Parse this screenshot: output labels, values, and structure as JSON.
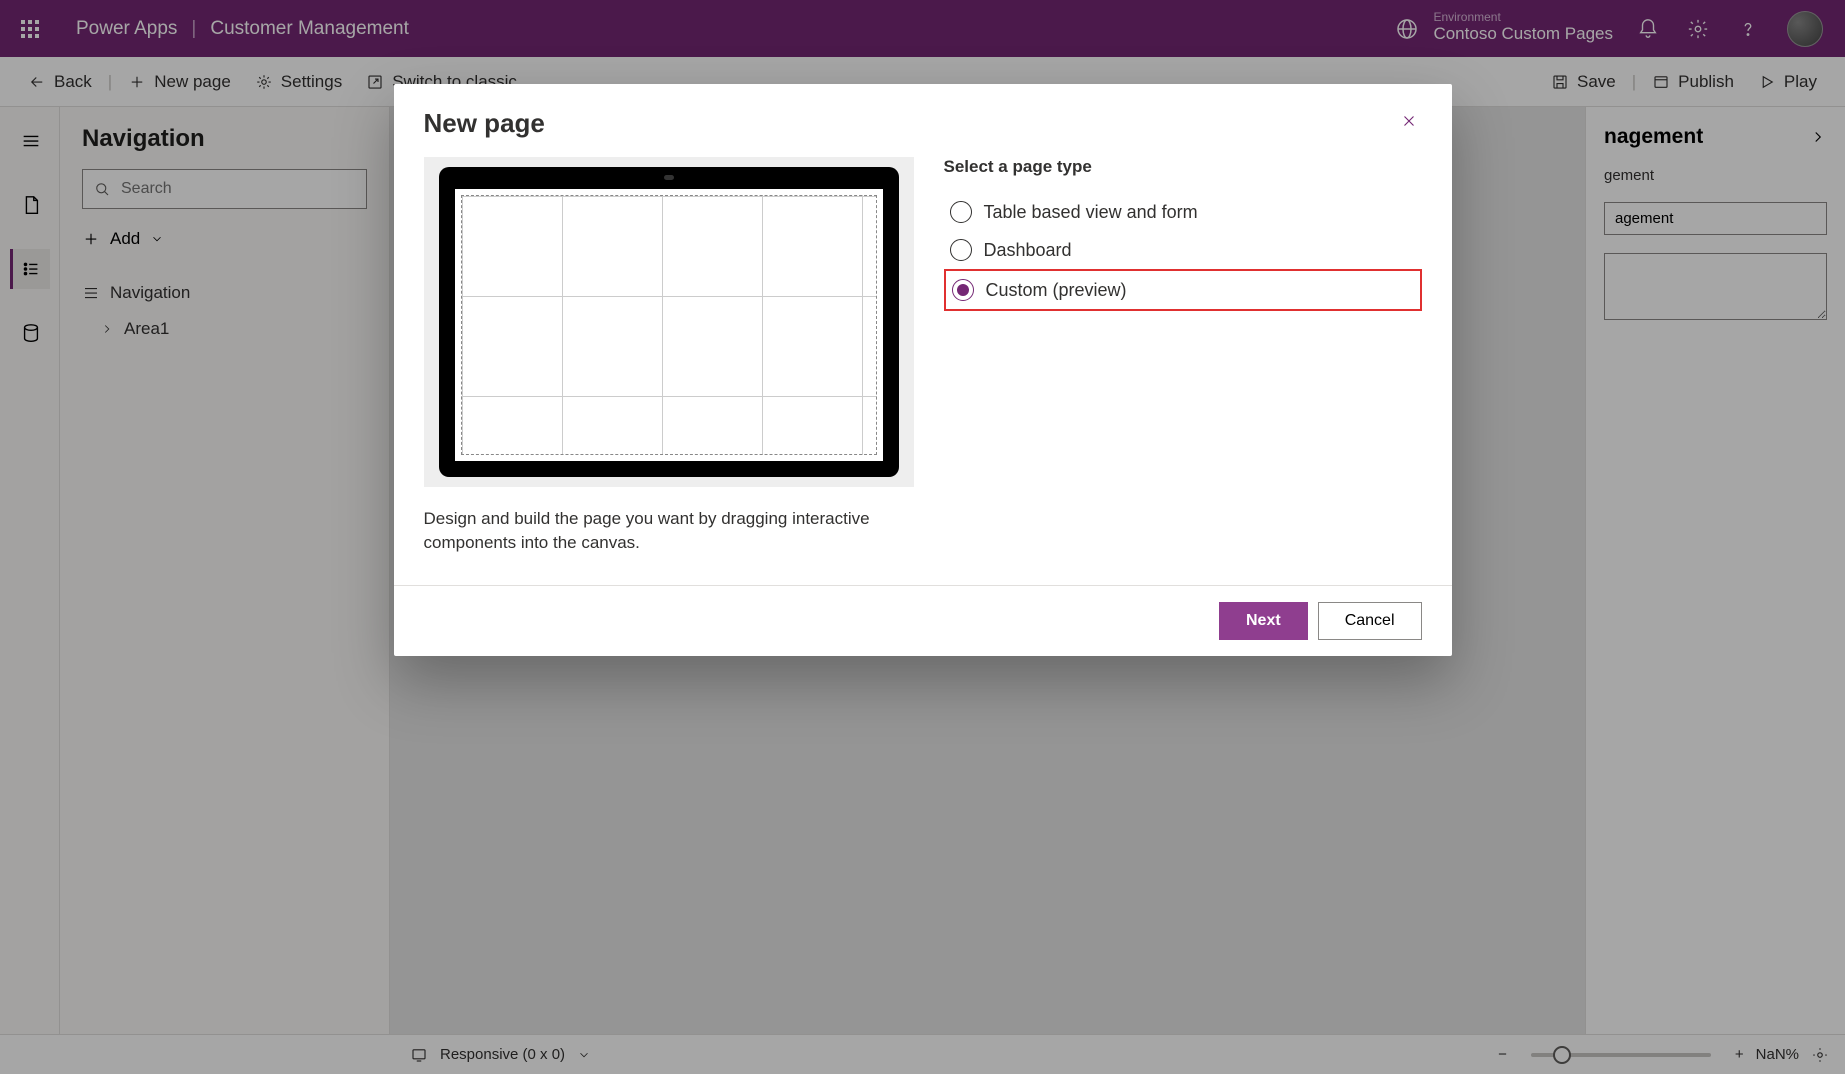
{
  "topbar": {
    "appName": "Power Apps",
    "separator": "|",
    "pageName": "Customer Management",
    "envLabel": "Environment",
    "envName": "Contoso Custom Pages"
  },
  "cmdbar": {
    "back": "Back",
    "newPage": "New page",
    "settings": "Settings",
    "switch": "Switch to classic",
    "save": "Save",
    "publish": "Publish",
    "play": "Play"
  },
  "nav": {
    "title": "Navigation",
    "searchPlaceholder": "Search",
    "add": "Add",
    "items": [
      "Navigation",
      "Area1"
    ]
  },
  "right": {
    "title": "nagement",
    "val1": "gement",
    "val2": "agement"
  },
  "status": {
    "responsive": "Responsive (0 x 0)",
    "zoom": "NaN%"
  },
  "dialog": {
    "title": "New page",
    "optionsTitle": "Select a page type",
    "options": [
      {
        "label": "Table based view and form",
        "selected": false,
        "highlight": false
      },
      {
        "label": "Dashboard",
        "selected": false,
        "highlight": false
      },
      {
        "label": "Custom (preview)",
        "selected": true,
        "highlight": true
      }
    ],
    "description": "Design and build the page you want by dragging interactive components into the canvas.",
    "next": "Next",
    "cancel": "Cancel"
  }
}
